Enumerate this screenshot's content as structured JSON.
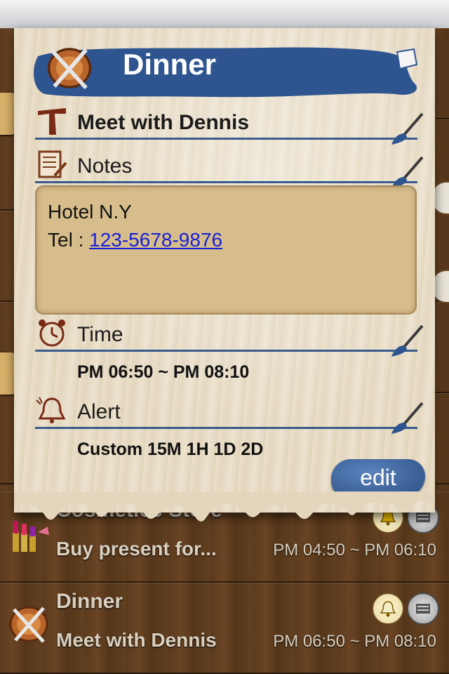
{
  "popup": {
    "title": "Dinner",
    "subject": "Meet with Dennis",
    "notes_label": "Notes",
    "notes_line1": "Hotel N.Y",
    "notes_tel_prefix": "Tel : ",
    "notes_tel_link": "123-5678-9876",
    "time_label": "Time",
    "time_value": "PM 06:50 ~ PM 08:10",
    "alert_label": "Alert",
    "alert_value": "Custom 15M 1H 1D 2D",
    "edit_label": "edit"
  },
  "list": {
    "items": [
      {
        "title": "Cosmetics Store",
        "subtitle": "Buy present for...",
        "time": "PM 04:50 ~ PM 06:10",
        "icon": "lipstick-icon"
      },
      {
        "title": "Dinner",
        "subtitle": "Meet with Dennis",
        "time": "PM 06:50 ~ PM 08:10",
        "icon": "dinner-plate-icon"
      }
    ]
  },
  "colors": {
    "banner_blue": "#2f5590",
    "wood_dark": "#5b3a1d",
    "paper": "#e6dac3",
    "accent_brown": "#7a3b1a"
  }
}
